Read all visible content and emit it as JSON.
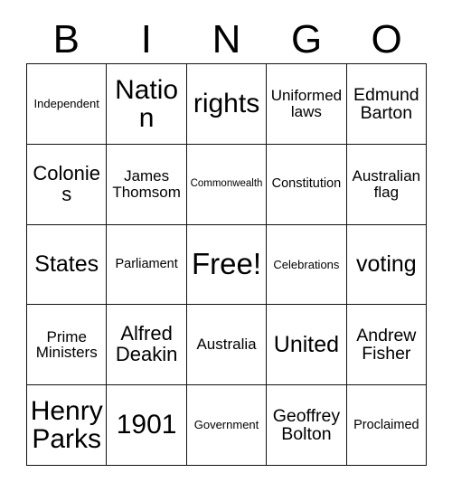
{
  "card": {
    "title": "BINGO",
    "header_letters": [
      "B",
      "I",
      "N",
      "G",
      "O"
    ],
    "free_space_label": "Free!",
    "colors": {
      "text": "#000000",
      "border": "#111111",
      "background": "#ffffff"
    },
    "rows": [
      [
        {
          "label": "Independent",
          "size": "sm"
        },
        {
          "label": "Nation",
          "size": "huge"
        },
        {
          "label": "rights",
          "size": "huge"
        },
        {
          "label": "Uniformed laws",
          "size": "md"
        },
        {
          "label": "Edmund Barton",
          "size": "lg"
        }
      ],
      [
        {
          "label": "Colonies",
          "size": "xl"
        },
        {
          "label": "James Thomsom",
          "size": "md"
        },
        {
          "label": "Commonwealth",
          "size": "xs"
        },
        {
          "label": "Constitution",
          "size": "smd"
        },
        {
          "label": "Australian flag",
          "size": "md"
        }
      ],
      [
        {
          "label": "States",
          "size": "xxl"
        },
        {
          "label": "Parliament",
          "size": "smd"
        },
        {
          "label": "Free!",
          "size": "free"
        },
        {
          "label": "Celebrations",
          "size": "sm"
        },
        {
          "label": "voting",
          "size": "xxl"
        }
      ],
      [
        {
          "label": "Prime Ministers",
          "size": "md"
        },
        {
          "label": "Alfred Deakin",
          "size": "xl"
        },
        {
          "label": "Australia",
          "size": "md"
        },
        {
          "label": "United",
          "size": "xxl"
        },
        {
          "label": "Andrew Fisher",
          "size": "lg"
        }
      ],
      [
        {
          "label": "Henry Parks",
          "size": "huge"
        },
        {
          "label": "1901",
          "size": "huge"
        },
        {
          "label": "Government",
          "size": "sm"
        },
        {
          "label": "Geoffrey Bolton",
          "size": "lg"
        },
        {
          "label": "Proclaimed",
          "size": "smd"
        }
      ]
    ]
  }
}
